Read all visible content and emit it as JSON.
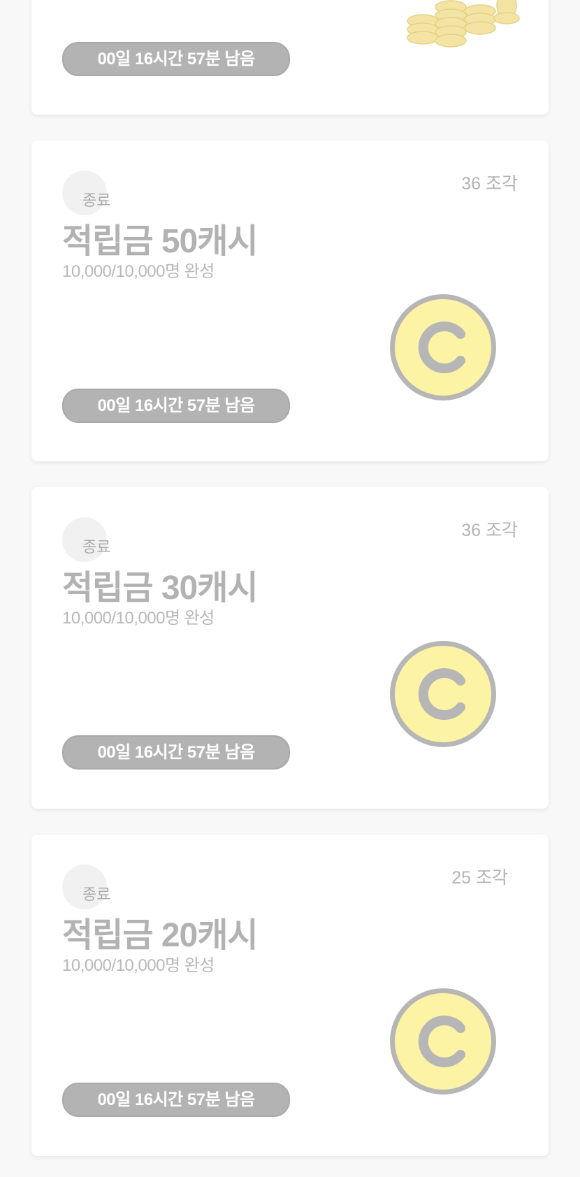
{
  "top_card": {
    "timer": "00일 16시간 57분 남음"
  },
  "cards": [
    {
      "pieces": "36 조각",
      "status": "종료",
      "title": "적립금 50캐시",
      "progress": "10,000/10,000명 완성",
      "timer": "00일 16시간 57분 남음"
    },
    {
      "pieces": "36 조각",
      "status": "종료",
      "title": "적립금 30캐시",
      "progress": "10,000/10,000명 완성",
      "timer": "00일 16시간 57분 남음"
    },
    {
      "pieces": "25 조각",
      "status": "종료",
      "title": "적립금 20캐시",
      "progress": "10,000/10,000명 완성",
      "timer": "00일 16시간 57분 남음"
    }
  ],
  "colors": {
    "coin_fill": "#fdf3a5",
    "coin_border": "#b6b6b6",
    "timer_bg": "#b3b3b3"
  },
  "icons": {
    "coin": "coin-c-icon",
    "coin_pile": "coin-pile-image"
  }
}
